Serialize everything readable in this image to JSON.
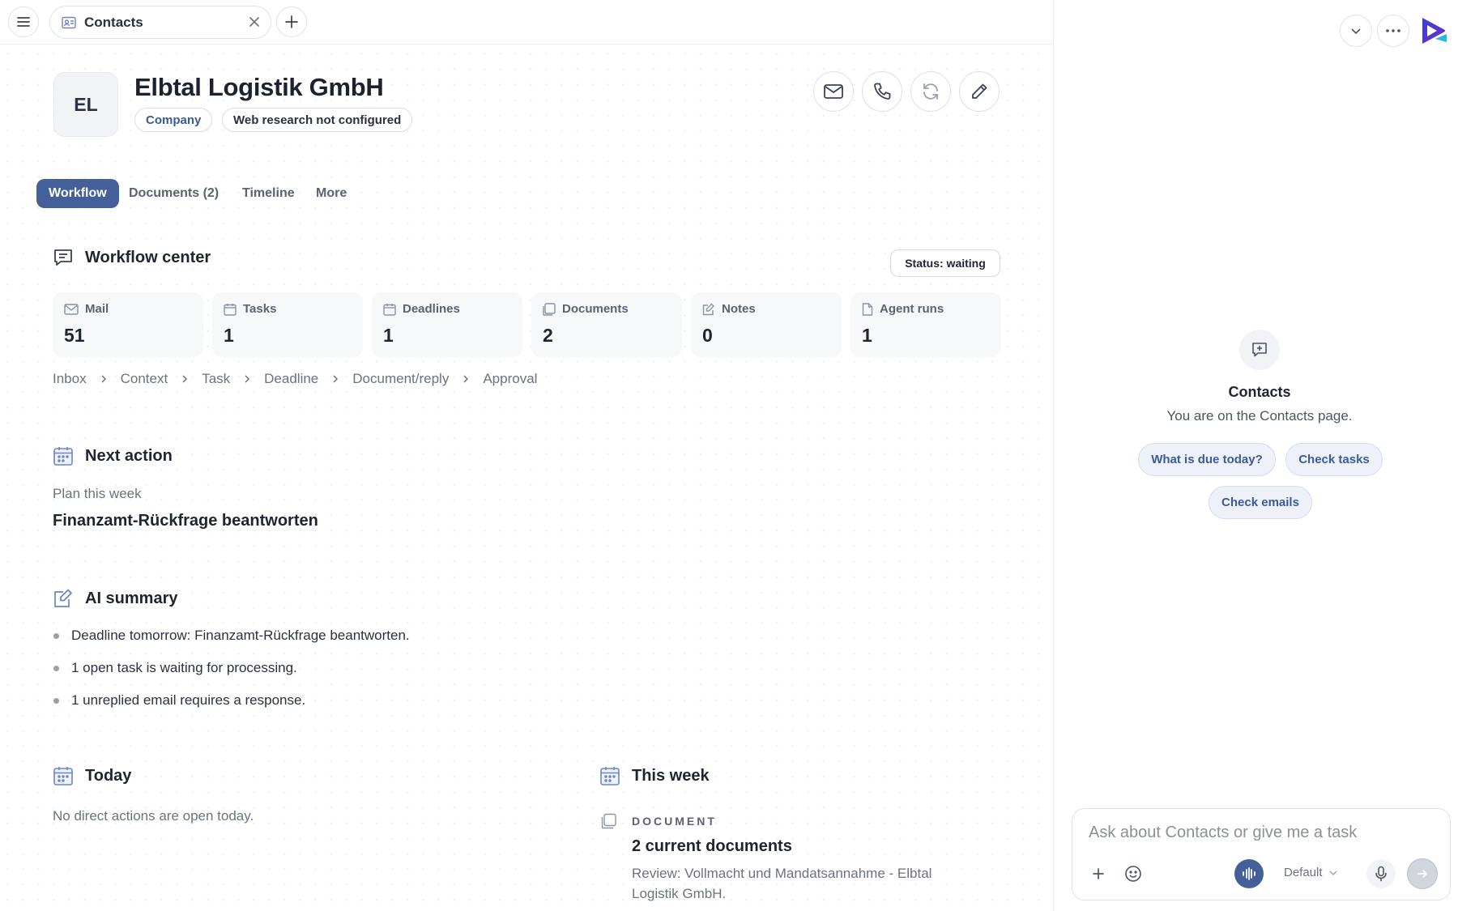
{
  "top_tab": {
    "label": "Contacts",
    "icon": "contacts-icon"
  },
  "contact": {
    "initials": "EL",
    "name": "Elbtal Logistik GmbH",
    "chips": {
      "type": "Company",
      "research": "Web research not configured"
    }
  },
  "actions": [
    "mail-icon",
    "phone-icon",
    "refresh-icon",
    "edit-icon"
  ],
  "tabs": {
    "workflow": "Workflow",
    "documents": "Documents (2)",
    "timeline": "Timeline",
    "more": "More"
  },
  "workflow_center": {
    "title": "Workflow center",
    "status": "Status: waiting",
    "stats": [
      {
        "label": "Mail",
        "value": "51",
        "icon": "mail-icon"
      },
      {
        "label": "Tasks",
        "value": "1",
        "icon": "calendar-icon"
      },
      {
        "label": "Deadlines",
        "value": "1",
        "icon": "calendar-icon"
      },
      {
        "label": "Documents",
        "value": "2",
        "icon": "document-icon"
      },
      {
        "label": "Notes",
        "value": "0",
        "icon": "note-icon"
      },
      {
        "label": "Agent runs",
        "value": "1",
        "icon": "file-icon"
      }
    ],
    "pipeline": [
      "Inbox",
      "Context",
      "Task",
      "Deadline",
      "Document/reply",
      "Approval"
    ]
  },
  "next_action": {
    "title": "Next action",
    "subtitle": "Plan this week",
    "item": "Finanzamt-Rückfrage beantworten"
  },
  "ai_summary": {
    "title": "AI summary",
    "items": [
      "Deadline tomorrow: Finanzamt-Rückfrage beantworten.",
      "1 open task is waiting for processing.",
      "1 unreplied email requires a response."
    ]
  },
  "today": {
    "title": "Today",
    "empty": "No direct actions are open today."
  },
  "this_week": {
    "title": "This week",
    "item": {
      "tag": "DOCUMENT",
      "title": "2 current documents",
      "desc": "Review: Vollmacht und Mandatsannahme - Elbtal Logistik GmbH."
    }
  },
  "assistant": {
    "title": "Contacts",
    "subtitle": "You are on the Contacts page.",
    "suggestions": [
      "What is due today?",
      "Check tasks",
      "Check emails"
    ],
    "input_placeholder": "Ask about Contacts or give me a task",
    "model": "Default"
  },
  "colors": {
    "accent": "#43609a",
    "chip_text": "#3a5a9a",
    "muted": "#6b7280"
  }
}
